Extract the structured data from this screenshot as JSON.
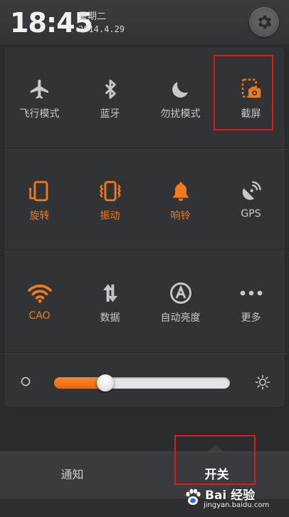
{
  "header": {
    "time": "18:45",
    "weekday": "星期二",
    "date": "2014.4.29",
    "settings_icon": "gear-icon"
  },
  "toggles": {
    "row1": [
      {
        "label": "飞行模式",
        "icon": "airplane-icon",
        "state": "off"
      },
      {
        "label": "蓝牙",
        "icon": "bluetooth-icon",
        "state": "off"
      },
      {
        "label": "勿扰模式",
        "icon": "moon-icon",
        "state": "off"
      },
      {
        "label": "截屏",
        "icon": "screenshot-icon",
        "state": "on"
      }
    ],
    "row2": [
      {
        "label": "旋转",
        "icon": "rotate-icon",
        "state": "on"
      },
      {
        "label": "振动",
        "icon": "vibrate-icon",
        "state": "on"
      },
      {
        "label": "响铃",
        "icon": "bell-icon",
        "state": "on"
      },
      {
        "label": "GPS",
        "icon": "gps-icon",
        "state": "off"
      }
    ],
    "row3": [
      {
        "label": "CAO",
        "icon": "wifi-icon",
        "state": "on"
      },
      {
        "label": "数据",
        "icon": "data-arrows-icon",
        "state": "off"
      },
      {
        "label": "自动亮度",
        "icon": "auto-brightness-icon",
        "state": "off"
      },
      {
        "label": "更多",
        "icon": "more-dots-icon",
        "state": "off"
      }
    ]
  },
  "brightness": {
    "level": 0.29,
    "min_icon": "dim-icon",
    "max_icon": "sun-icon"
  },
  "tabs": {
    "notify": "通知",
    "switch": "开关",
    "active": "switch"
  },
  "watermark": {
    "brand": "Bai 经验",
    "url": "jingyan.baidu.com"
  },
  "colors": {
    "accent": "#f07a1e",
    "highlight": "#e0191d",
    "panel": "#323335",
    "icon_off": "#c9c9c9"
  }
}
